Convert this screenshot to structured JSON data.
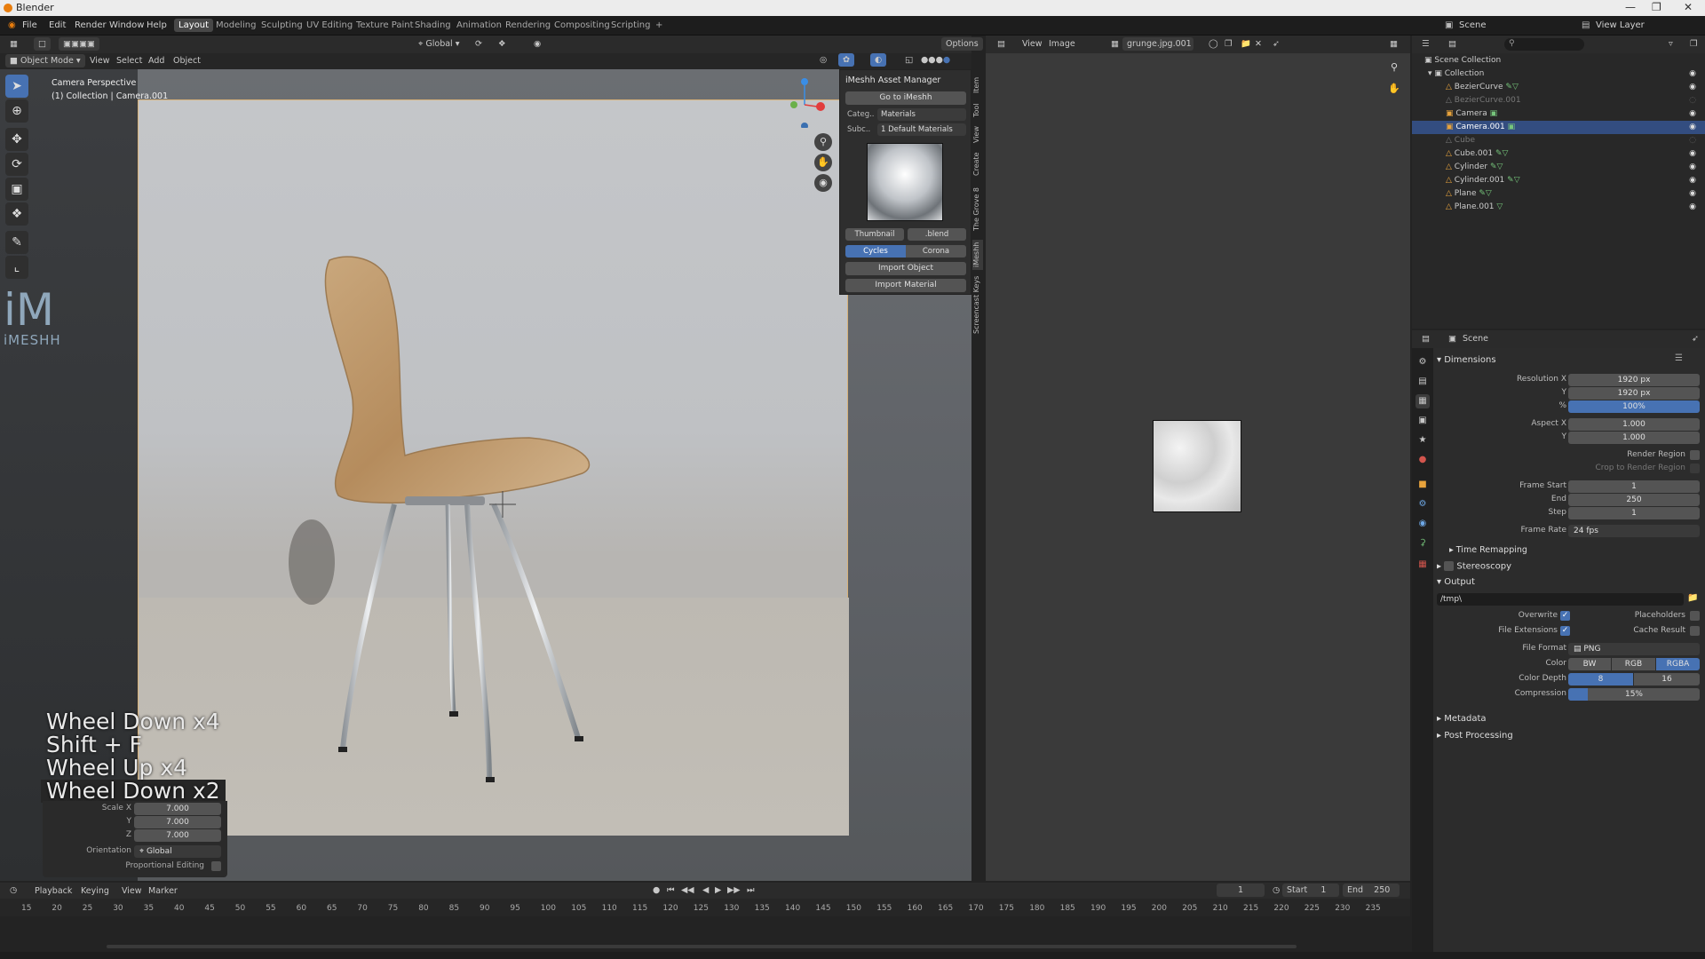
{
  "app": {
    "title": "Blender"
  },
  "menu": [
    "File",
    "Edit",
    "Render",
    "Window",
    "Help"
  ],
  "workspaces": [
    "Layout",
    "Modeling",
    "Sculpting",
    "UV Editing",
    "Texture Paint",
    "Shading",
    "Animation",
    "Rendering",
    "Compositing",
    "Scripting"
  ],
  "workspace_add": "+",
  "header": {
    "transform": "Global",
    "options": "Options"
  },
  "viewport_menu": {
    "mode": "Object Mode",
    "items": [
      "View",
      "Select",
      "Add",
      "Object"
    ]
  },
  "viewport": {
    "perspective": "Camera Perspective",
    "collection": "(1) Collection | Camera.001"
  },
  "logo": {
    "mark": "iM",
    "text": "iMESHH"
  },
  "keystrokes": [
    "Wheel Down x4",
    "Shift + F",
    "Wheel Up x4",
    "Wheel Down x2"
  ],
  "operator": {
    "scale_x_label": "Scale X",
    "scale_x": "7.000",
    "y_label": "Y",
    "y": "7.000",
    "z_label": "Z",
    "z": "7.000",
    "orientation_label": "Orientation",
    "orientation": "Global",
    "prop_edit_label": "Proportional Editing"
  },
  "asset_panel": {
    "title": "iMeshh Asset Manager",
    "goto": "Go to iMeshh",
    "category_label": "Categ..",
    "category": "Materials",
    "subcategory_label": "Subc..",
    "subcategory": "1 Default Materials",
    "thumbnail": "Thumbnail",
    "blend": ".blend",
    "engine_cycles": "Cycles",
    "engine_corona": "Corona",
    "import_object": "Import Object",
    "import_material": "Import Material"
  },
  "side_tabs": [
    "Item",
    "Tool",
    "View",
    "Create",
    "The Grove 8",
    "iMeshh",
    "Screencast Keys"
  ],
  "image_editor": {
    "menu": [
      "View",
      "Image"
    ],
    "image_name": "grunge.jpg.001"
  },
  "top_right": {
    "scene": "Scene",
    "view_layer": "View Layer"
  },
  "outliner": {
    "root": "Scene Collection",
    "collection": "Collection",
    "items": [
      "BezierCurve",
      "BezierCurve.001",
      "Camera",
      "Camera.001",
      "Cube",
      "Cube.001",
      "Cylinder",
      "Cylinder.001",
      "Plane",
      "Plane.001"
    ]
  },
  "properties": {
    "context": "Scene",
    "dimensions": "Dimensions",
    "res_x_label": "Resolution X",
    "res_x": "1920 px",
    "res_y_label": "Y",
    "res_y": "1920 px",
    "res_pct_label": "%",
    "res_pct": "100%",
    "aspect_x_label": "Aspect X",
    "aspect_x": "1.000",
    "aspect_y_label": "Y",
    "aspect_y": "1.000",
    "render_region": "Render Region",
    "crop_region": "Crop to Render Region",
    "frame_start_label": "Frame Start",
    "frame_start": "1",
    "end_label": "End",
    "end": "250",
    "step_label": "Step",
    "step": "1",
    "frame_rate_label": "Frame Rate",
    "frame_rate": "24 fps",
    "time_remapping": "Time Remapping",
    "stereoscopy": "Stereoscopy",
    "output": "Output",
    "output_path": "/tmp\\",
    "overwrite": "Overwrite",
    "placeholders": "Placeholders",
    "file_extensions": "File Extensions",
    "cache_result": "Cache Result",
    "file_format_label": "File Format",
    "file_format": "PNG",
    "color_label": "Color",
    "color_bw": "BW",
    "color_rgb": "RGB",
    "color_rgba": "RGBA",
    "depth_label": "Color Depth",
    "depth_8": "8",
    "depth_16": "16",
    "compression_label": "Compression",
    "compression": "15%",
    "compression_value": 0.15,
    "metadata": "Metadata",
    "post_processing": "Post Processing"
  },
  "timeline": {
    "menu": [
      "Playback",
      "Keying",
      "View",
      "Marker"
    ],
    "current_frame": "1",
    "start_label": "Start",
    "start": "1",
    "end_label": "End",
    "end": "250",
    "ticks": [
      "15",
      "20",
      "25",
      "30",
      "35",
      "40",
      "45",
      "50",
      "55",
      "60",
      "65",
      "70",
      "75",
      "80",
      "85",
      "90",
      "95",
      "100",
      "105",
      "110",
      "115",
      "120",
      "125",
      "130",
      "135",
      "140",
      "145",
      "150",
      "155",
      "160",
      "165",
      "170",
      "175",
      "180",
      "185",
      "190",
      "195",
      "200",
      "205",
      "210",
      "215",
      "220",
      "225",
      "230",
      "235"
    ]
  },
  "colors": {
    "accent": "#4772b3",
    "active_object": "#e87d0d"
  }
}
